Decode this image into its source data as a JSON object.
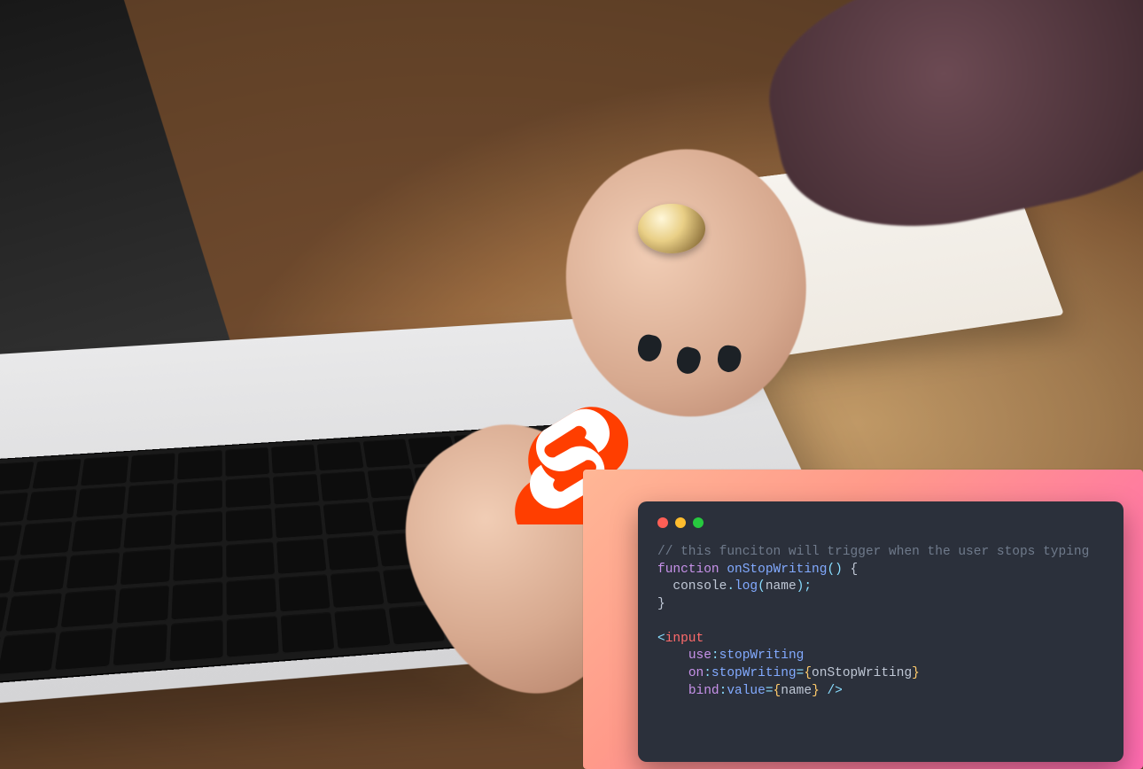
{
  "logo": {
    "name": "svelte"
  },
  "code": {
    "comment": "// this funciton will trigger when the user stops typing",
    "kw_function": "function",
    "fn_name": "onStopWriting",
    "fn_parens": "()",
    "brace_open": " {",
    "body_indent": "  ",
    "console": "console",
    "dot": ".",
    "log": "log",
    "open_paren": "(",
    "arg_name": "name",
    "close_call": ");",
    "brace_close": "}",
    "lt": "<",
    "tag_input": "input",
    "indent": "    ",
    "attr_use": "use",
    "colon": ":",
    "val_stopWriting": "stopWriting",
    "attr_on": "on",
    "eq": "=",
    "curly_open": "{",
    "handler": "onStopWriting",
    "curly_close": "}",
    "attr_bind": "bind",
    "val_value": "value",
    "space": " ",
    "self_close": "/>"
  }
}
